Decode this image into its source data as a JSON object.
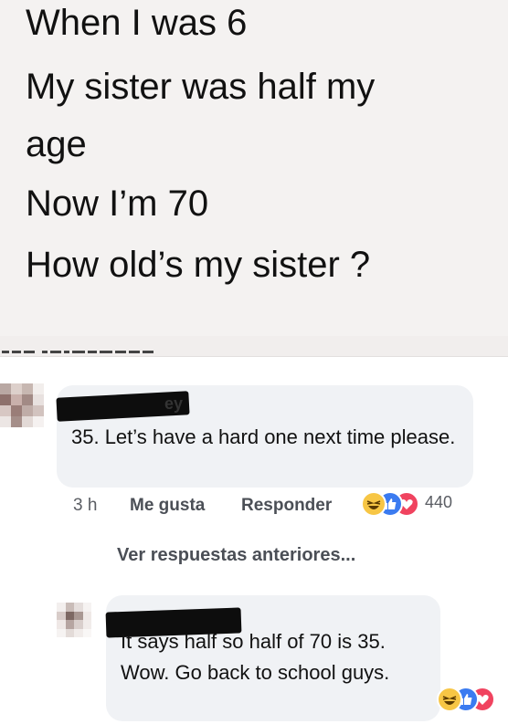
{
  "post": {
    "lines": [
      "When I was 6",
      "My sister was half my",
      "age",
      "Now I’m 70",
      "How old’s my sister ?"
    ]
  },
  "comment1": {
    "text": "35. Let’s have a hard one next time please.",
    "name_visible_fragment": "ey",
    "time": "3 h",
    "like_label": "Me gusta",
    "reply_label": "Responder",
    "reaction_count": "440",
    "reactions": [
      "haha-icon",
      "like-icon",
      "love-icon"
    ]
  },
  "view_previous": "Ver respuestas anteriores...",
  "reply1": {
    "text": "It says half so half of 70 is 35. Wow. Go back to school guys.",
    "reactions": [
      "haha-icon",
      "like-icon",
      "love-icon"
    ]
  },
  "colors": {
    "post_bg": "#f4f2f1",
    "bubble_bg": "#f0f2f5",
    "haha": "#f7c645",
    "like": "#3b7bf0",
    "love": "#f0435f"
  }
}
